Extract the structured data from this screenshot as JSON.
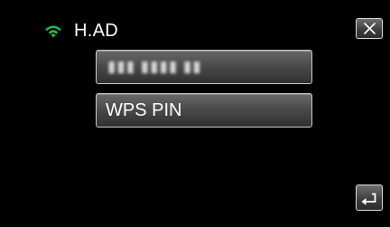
{
  "header": {
    "network_name": "H.AD",
    "signal_icon": "wifi-signal-icon"
  },
  "colors": {
    "signal": "#2db34a",
    "background": "#000000",
    "button_border": "#d9d9d9"
  },
  "entry_field": {
    "masked_value": "▮▮▮ ▮▮▮▮ ▮▮"
  },
  "wps_button": {
    "label": "WPS PIN"
  },
  "controls": {
    "close_icon": "close-icon",
    "back_icon": "return-arrow-icon"
  }
}
